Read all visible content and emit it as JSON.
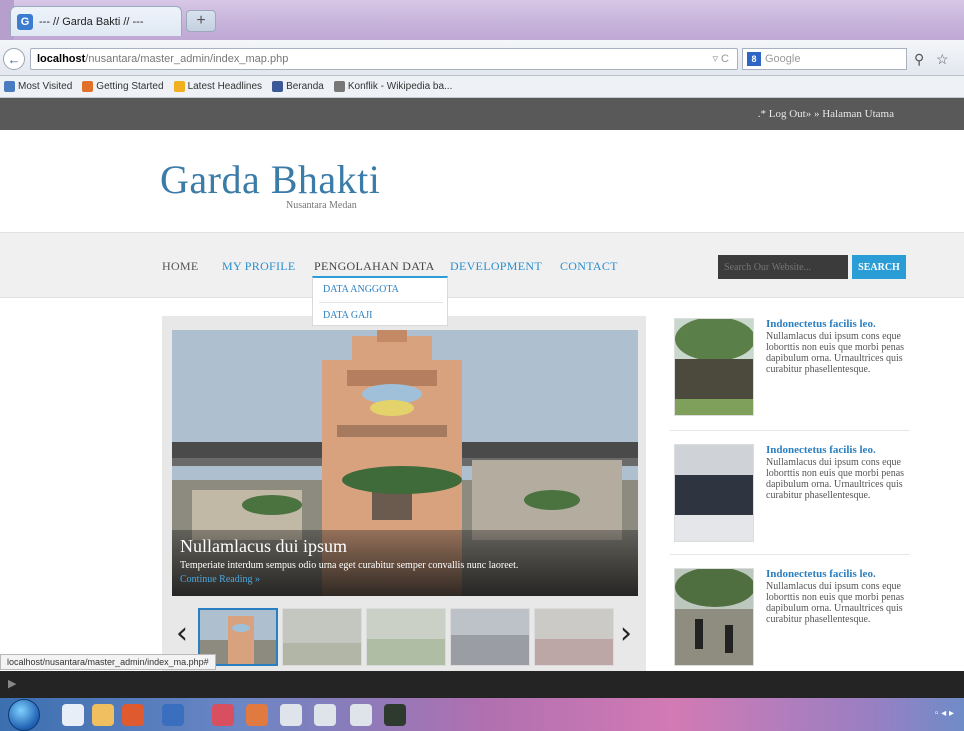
{
  "browser": {
    "tab_title": "--- // Garda Bakti // ---",
    "new_tab_symbol": "+",
    "url_host": "localhost",
    "url_path": "/nusantara/master_admin/index_map.php",
    "url_icons": "▿ C",
    "search_placeholder": "Google",
    "search_engine_letter": "8",
    "back_arrow": "←",
    "search_icon": "⚲",
    "star_icon": "☆",
    "bookmarks": [
      {
        "label": "Most Visited",
        "color": "#4a7cc0"
      },
      {
        "label": "Getting Started",
        "color": "#e0702a"
      },
      {
        "label": "Latest Headlines",
        "color": "#f0b020"
      },
      {
        "label": "Beranda",
        "color": "#3b5998"
      },
      {
        "label": "Konflik - Wikipedia ba...",
        "color": "#777777"
      }
    ]
  },
  "site": {
    "topbar_links": ".* Log Out» » Halaman Utama",
    "brand": "Garda Bhakti",
    "brand_sub": "Nusantara Medan",
    "menu": [
      {
        "label": "HOME",
        "color": "#555555"
      },
      {
        "label": "MY PROFILE",
        "color": "#2a8fd0"
      },
      {
        "label": "PENGOLAHAN DATA",
        "color": "#444444"
      },
      {
        "label": "DEVELOPMENT",
        "color": "#2a8fd0"
      },
      {
        "label": "CONTACT",
        "color": "#2a8fd0"
      }
    ],
    "search_placeholder": "Search Our Website...",
    "search_button": "SEARCH",
    "dropdown": [
      "DATA ANGGOTA",
      "DATA GAJI"
    ],
    "slider": {
      "title": "Nullamlacus dui ipsum",
      "text": "Temperiate interdum sempus odio urna eget curabitur semper convallis nunc laoreet.",
      "link": "Continue Reading »",
      "prev": "‹",
      "next": "›"
    },
    "news": [
      {
        "title": "Indonectetus facilis leo.",
        "body": "Nullamlacus dui ipsum cons eque loborttis non euis que morbi penas dapibulum orna. Urnaultrices quis curabitur phasellentesque."
      },
      {
        "title": "Indonectetus facilis leo.",
        "body": "Nullamlacus dui ipsum cons eque loborttis non euis que morbi penas dapibulum orna. Urnaultrices quis curabitur phasellentesque."
      },
      {
        "title": "Indonectetus facilis leo.",
        "body": "Nullamlacus dui ipsum cons eque loborttis non euis que morbi penas dapibulum orna. Urnaultrices quis curabitur phasellentesque."
      }
    ],
    "status_url": "localhost/nusantara/master_admin/index_ma.php#"
  },
  "colors": {
    "accent": "#2a9dd7",
    "brand": "#3b7ba8",
    "topbar": "#595959"
  }
}
